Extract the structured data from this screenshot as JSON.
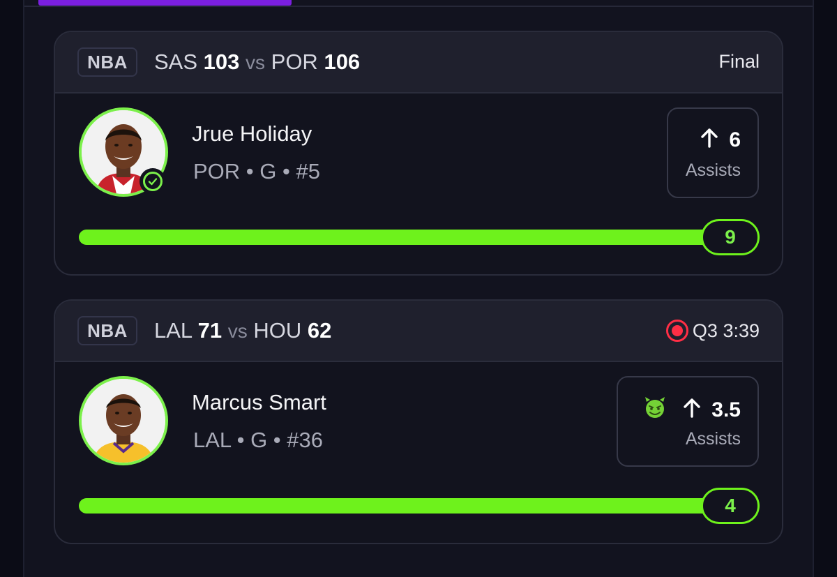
{
  "cards": [
    {
      "league": "NBA",
      "home_team": "SAS",
      "home_score": "103",
      "vs": "vs",
      "away_team": "POR",
      "away_score": "106",
      "status": "Final",
      "player": {
        "name": "Jrue Holiday",
        "meta": "POR • G • #5",
        "hit_icon": "check-circle-icon"
      },
      "pick": {
        "direction_icon": "arrow-up-icon",
        "line": "6",
        "stat": "Assists"
      },
      "progress": {
        "result": "9",
        "fill_fraction": 1.0
      }
    },
    {
      "league": "NBA",
      "home_team": "LAL",
      "home_score": "71",
      "vs": "vs",
      "away_team": "HOU",
      "away_score": "62",
      "status": "Q3 3:39",
      "status_icon": "live-record-icon",
      "player": {
        "name": "Marcus Smart",
        "meta": "LAL • G • #36"
      },
      "pick": {
        "badge_icon": "devil-emoji-icon",
        "direction_icon": "arrow-up-icon",
        "line": "3.5",
        "stat": "Assists"
      },
      "progress": {
        "result": "4",
        "fill_fraction": 1.0
      }
    }
  ],
  "colors": {
    "accent_green": "#6ef21c",
    "live_red": "#ff2e45",
    "tab_purple": "#7b1fe0"
  }
}
